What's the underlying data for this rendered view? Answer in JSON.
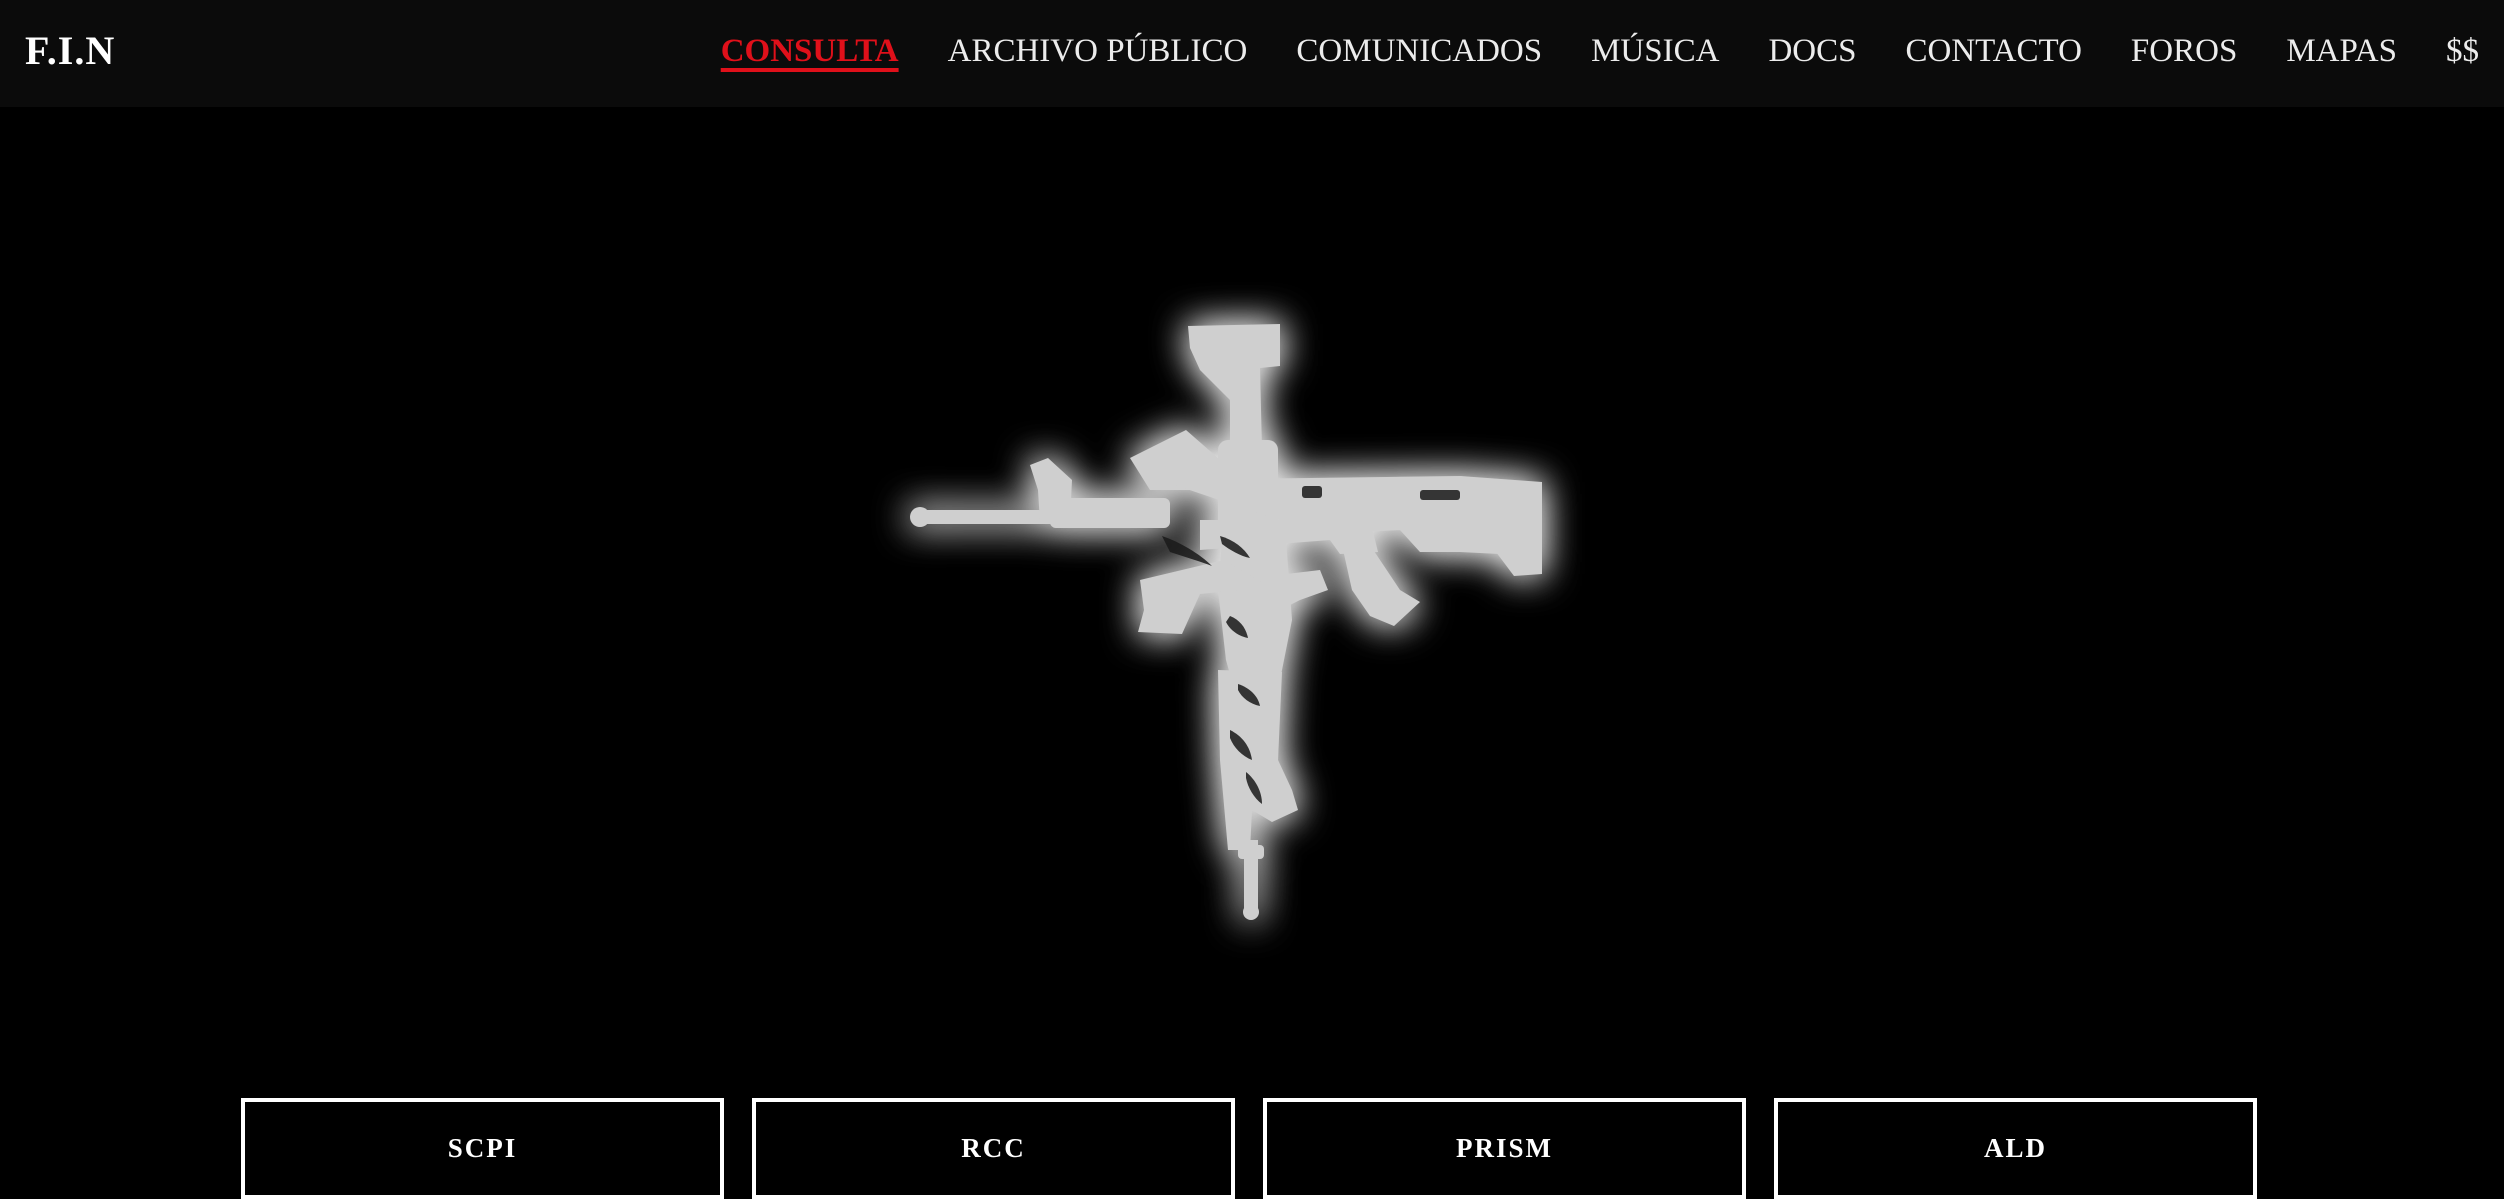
{
  "header": {
    "logo": "F.I.N",
    "nav": [
      {
        "label": "CONSULTA",
        "active": true
      },
      {
        "label": "ARCHIVO PÚBLICO",
        "active": false
      },
      {
        "label": "COMUNICADOS",
        "active": false
      },
      {
        "label": "MÚSICA",
        "active": false
      },
      {
        "label": "DOCS",
        "active": false
      },
      {
        "label": "CONTACTO",
        "active": false
      },
      {
        "label": "FOROS",
        "active": false
      },
      {
        "label": "MAPAS",
        "active": false
      },
      {
        "label": "$$",
        "active": false
      }
    ]
  },
  "hero": {
    "emblem_icon": "rifle-cross-icon",
    "emblem_color": "#cfcfcf",
    "glow_color": "#ffffff"
  },
  "buttons": [
    {
      "label": "SCPI"
    },
    {
      "label": "RCC"
    },
    {
      "label": "PRISM"
    },
    {
      "label": "ALD"
    }
  ],
  "colors": {
    "background": "#000000",
    "topbar": "#0b0b0b",
    "accent": "#e0101a",
    "text": "#ececec"
  }
}
